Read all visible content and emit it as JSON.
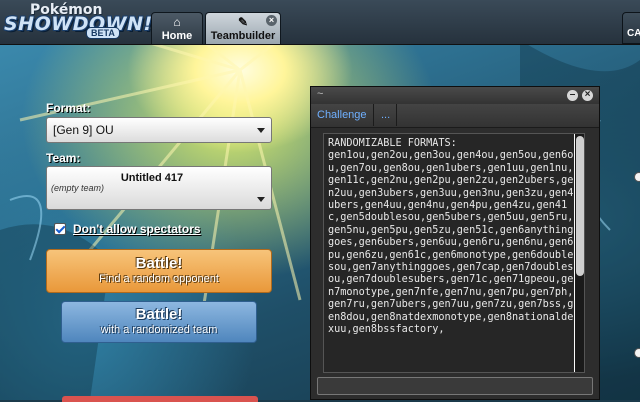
{
  "header": {
    "logo_line1": "Pokémon",
    "logo_line2": "SHOWDOWN!",
    "logo_beta": "BETA",
    "tabs": [
      {
        "label": "Home",
        "icon": "home-icon"
      },
      {
        "label": "Teambuilder",
        "icon": "edit-icon"
      }
    ],
    "right_button_label": "CA"
  },
  "main": {
    "format_label": "Format:",
    "format_value": "[Gen 9] OU",
    "team_label": "Team:",
    "team_name": "Untitled 417",
    "team_sub": "(empty team)",
    "spectators_label": "Don't allow spectators",
    "spectators_checked": true,
    "battle_random_label": "Battle!",
    "battle_random_sub": "Find a random opponent",
    "battle_randomized_label": "Battle!",
    "battle_randomized_sub": "with a randomized team"
  },
  "popup": {
    "title": "~",
    "tabs": [
      "Challenge",
      "..."
    ],
    "log_text": "RANDOMIZABLE FORMATS:\ngen1ou,gen2ou,gen3ou,gen4ou,gen5ou,gen6ou,gen7ou,gen8ou,gen1ubers,gen1uu,gen1nu,gen11c,gen2nu,gen2pu,gen2zu,gen2ubers,gen2uu,gen3ubers,gen3uu,gen3nu,gen3zu,gen4ubers,gen4uu,gen4nu,gen4pu,gen4zu,gen41c,gen5doublesou,gen5ubers,gen5uu,gen5ru,gen5nu,gen5pu,gen5zu,gen51c,gen6anythinggoes,gen6ubers,gen6uu,gen6ru,gen6nu,gen6pu,gen6zu,gen61c,gen6monotype,gen6doublesou,gen7anythinggoes,gen7cap,gen7doublesou,gen7doublesubers,gen71c,gen71gpeou,gen7monotype,gen7nfe,gen7nu,gen7pu,gen7ph,gen7ru,gen7ubers,gen7uu,gen7zu,gen7bss,gen8dou,gen8natdexmonotype,gen8nationaldexuu,gen8bssfactory,"
  },
  "colors": {
    "battle_orange": "#e9983a",
    "battle_blue": "#4f86bd",
    "link_blue": "#6fb0ff"
  }
}
